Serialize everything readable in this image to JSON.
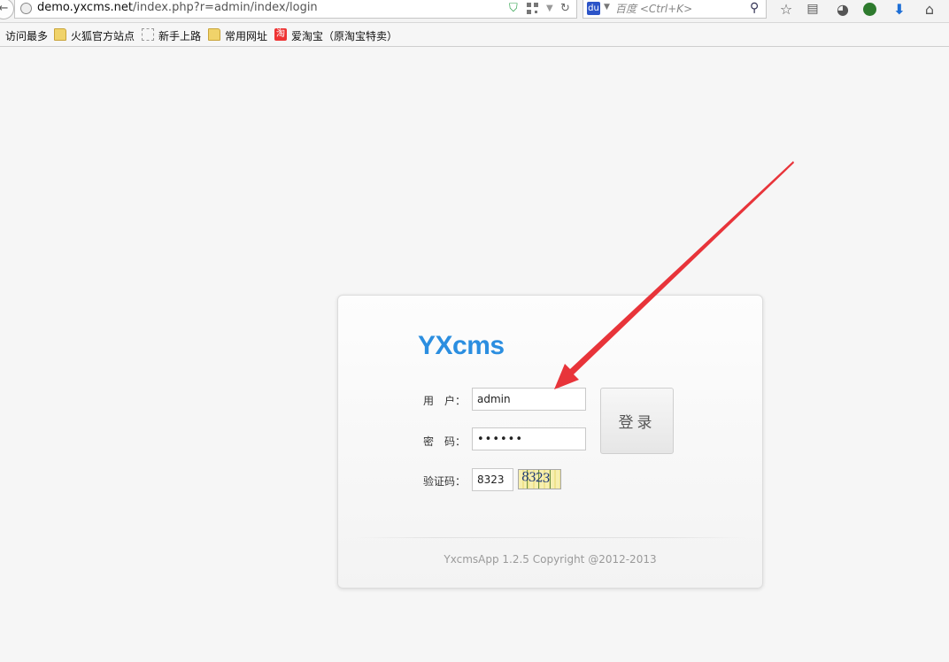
{
  "browser": {
    "url_domain": "demo.yxcms.net",
    "url_path": "/index.php?r=admin/index/login",
    "search_placeholder": "百度 <Ctrl+K>",
    "search_engine_glyph": "du"
  },
  "bookmarks": [
    {
      "label": "访问最多",
      "icon": "none"
    },
    {
      "label": "火狐官方站点",
      "icon": "folder-icon"
    },
    {
      "label": "新手上路",
      "icon": "blank-page-icon"
    },
    {
      "label": "常用网址",
      "icon": "folder-icon"
    },
    {
      "label": "爱淘宝（原淘宝特卖）",
      "icon": "taobao-icon",
      "icon_glyph": "淘"
    }
  ],
  "login": {
    "logo": "YXcms",
    "username_label": "用　户：",
    "username_value": "admin",
    "password_label": "密　码：",
    "password_value": "xxxxxx",
    "captcha_label": "验证码：",
    "captcha_value": "8323",
    "captcha_image_text": "8323",
    "submit_label": "登录",
    "copyright": "YxcmsApp 1.2.5 Copyright @2012-2013"
  },
  "colors": {
    "logo": "#2b8ee0",
    "annotation_arrow": "#e8343a"
  }
}
